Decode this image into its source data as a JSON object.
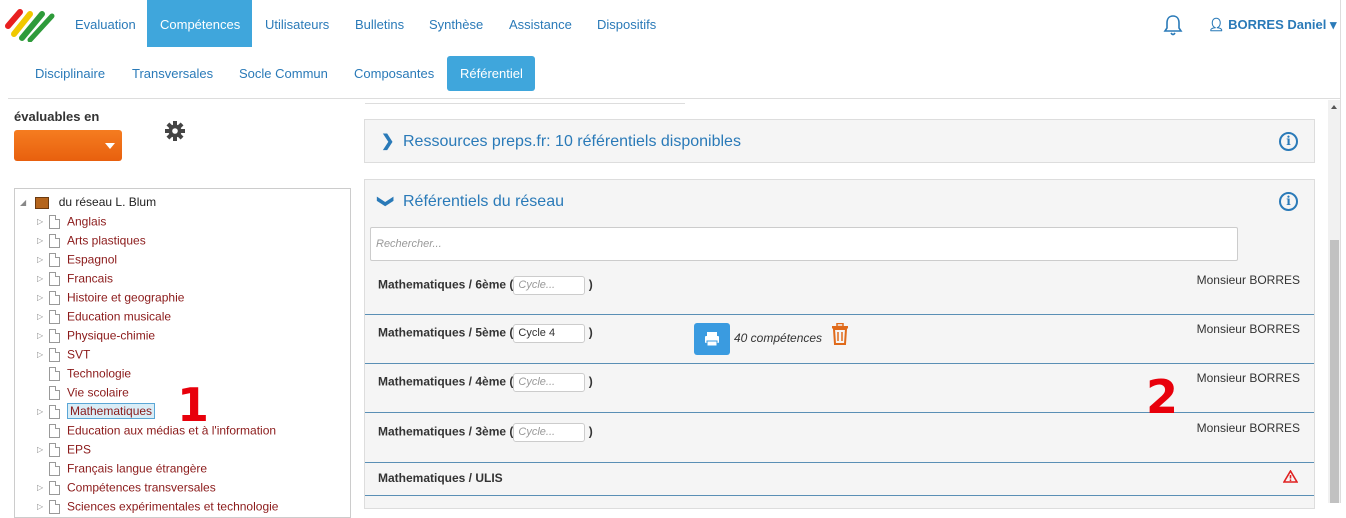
{
  "topnav": {
    "items": [
      "Evaluation",
      "Compétences",
      "Utilisateurs",
      "Bulletins",
      "Synthèse",
      "Assistance",
      "Dispositifs"
    ],
    "active_index": 1,
    "user": "BORRES Daniel",
    "user_caret": "▾"
  },
  "subnav": {
    "items": [
      "Disciplinaire",
      "Transversales",
      "Socle Commun",
      "Composantes",
      "Référentiel"
    ],
    "active_index": 4
  },
  "left": {
    "label": "évaluables en",
    "tree_root": "du réseau L. Blum",
    "nodes": [
      {
        "label": "Anglais",
        "expand": true
      },
      {
        "label": "Arts plastiques",
        "expand": true
      },
      {
        "label": "Espagnol",
        "expand": true
      },
      {
        "label": "Francais",
        "expand": true
      },
      {
        "label": "Histoire et geographie",
        "expand": true
      },
      {
        "label": "Education musicale",
        "expand": true
      },
      {
        "label": "Physique-chimie",
        "expand": true
      },
      {
        "label": "SVT",
        "expand": true
      },
      {
        "label": "Technologie",
        "expand": false
      },
      {
        "label": "Vie scolaire",
        "expand": false
      },
      {
        "label": "Mathematiques",
        "expand": true,
        "selected": true
      },
      {
        "label": "Education aux médias et à l'information",
        "expand": false
      },
      {
        "label": "EPS",
        "expand": true
      },
      {
        "label": "Français langue étrangère",
        "expand": false
      },
      {
        "label": "Compétences transversales",
        "expand": true
      },
      {
        "label": "Sciences expérimentales et technologie",
        "expand": true
      }
    ],
    "annotation": "1"
  },
  "right": {
    "panel1_title": "Ressources preps.fr: 10 référentiels disponibles",
    "panel2_title": "Référentiels du réseau",
    "search_placeholder": "Rechercher...",
    "rows": [
      {
        "title": "Mathematiques / 6ème",
        "cycle": "",
        "cycle_placeholder": "Cycle...",
        "owner": "Monsieur BORRES"
      },
      {
        "title": "Mathematiques / 5ème",
        "cycle": "Cycle 4",
        "cycle_placeholder": "Cycle...",
        "owner": "Monsieur BORRES",
        "competences": "40 compétences"
      },
      {
        "title": "Mathematiques / 4ème",
        "cycle": "",
        "cycle_placeholder": "Cycle...",
        "owner": "Monsieur BORRES"
      },
      {
        "title": "Mathematiques / 3ème",
        "cycle": "",
        "cycle_placeholder": "Cycle...",
        "owner": "Monsieur BORRES"
      },
      {
        "title": "Mathematiques / ULIS",
        "warning": true
      }
    ],
    "annotation": "2"
  },
  "colors": {
    "primary": "#3fa6dc",
    "link": "#2a7ab8",
    "orange": "#f57c20",
    "tree_label": "#8b1a1a",
    "annotation": "#e8000b"
  }
}
